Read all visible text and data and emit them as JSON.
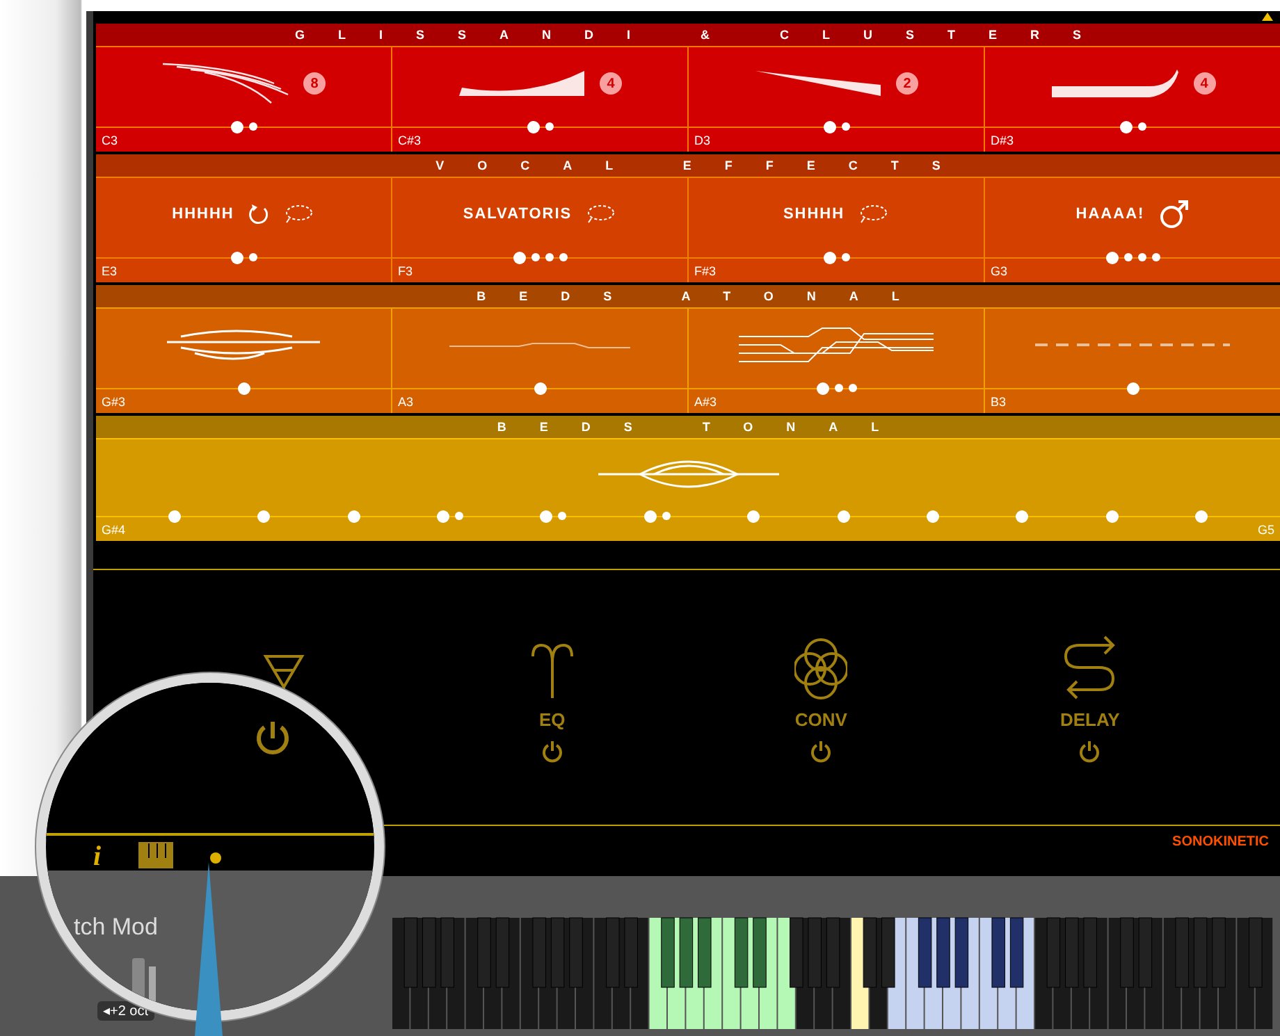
{
  "sections": [
    {
      "title": "GLISSANDI & CLUSTERS",
      "kind": "grid",
      "cells": [
        {
          "note": "C3",
          "badge": "8",
          "dots": [
            {
              "selected": true
            },
            {
              "selected": false
            }
          ]
        },
        {
          "note": "C#3",
          "badge": "4",
          "dots": [
            {
              "selected": true
            },
            {
              "selected": false
            }
          ]
        },
        {
          "note": "D3",
          "badge": "2",
          "dots": [
            {
              "selected": true
            },
            {
              "selected": false
            }
          ]
        },
        {
          "note": "D#3",
          "badge": "4",
          "dots": [
            {
              "selected": true
            },
            {
              "selected": false
            }
          ]
        }
      ]
    },
    {
      "title": "VOCAL EFFECTS",
      "kind": "grid",
      "cells": [
        {
          "note": "E3",
          "label": "HHHHH",
          "kind": "loop-bubble",
          "dots": [
            {
              "selected": true
            },
            {
              "selected": false
            }
          ]
        },
        {
          "note": "F3",
          "label": "SALVATORIS",
          "kind": "bubble",
          "dots": [
            {
              "selected": true
            },
            {
              "selected": false
            },
            {
              "selected": false
            },
            {
              "selected": false
            }
          ]
        },
        {
          "note": "F#3",
          "label": "SHHHH",
          "kind": "bubble",
          "dots": [
            {
              "selected": true
            },
            {
              "selected": false
            }
          ]
        },
        {
          "note": "G3",
          "label": "HAAAA!",
          "kind": "male",
          "dots": [
            {
              "selected": true
            },
            {
              "selected": false
            },
            {
              "selected": false
            },
            {
              "selected": false
            }
          ]
        }
      ]
    },
    {
      "title": "BEDS ATONAL",
      "kind": "grid",
      "cells": [
        {
          "note": "G#3",
          "dots": [
            {
              "selected": true
            }
          ]
        },
        {
          "note": "A3",
          "dots": [
            {
              "selected": true
            }
          ]
        },
        {
          "note": "A#3",
          "dots": [
            {
              "selected": true
            },
            {
              "selected": false
            },
            {
              "selected": false
            }
          ]
        },
        {
          "note": "B3",
          "dots": [
            {
              "selected": true
            }
          ]
        }
      ]
    },
    {
      "title": "BEDS TONAL",
      "kind": "wide",
      "cells": [
        {
          "note": "G#4",
          "note_end": "G5",
          "dots": [
            {
              "selected": true
            },
            {
              "selected": true
            },
            {
              "selected": true
            },
            {
              "selected": true
            },
            {
              "selected": false
            },
            {
              "selected": true
            },
            {
              "selected": false
            },
            {
              "selected": true
            },
            {
              "selected": false
            },
            {
              "selected": true
            },
            {
              "selected": true
            },
            {
              "selected": true
            },
            {
              "selected": true
            },
            {
              "selected": true
            },
            {
              "selected": true
            }
          ]
        }
      ]
    }
  ],
  "effects": [
    {
      "kind": "funnel"
    },
    {
      "kind": "eq",
      "label": "EQ"
    },
    {
      "kind": "conv",
      "label": "CONV"
    },
    {
      "kind": "delay",
      "label": "DELAY"
    }
  ],
  "brand": "SONOKINETIC",
  "magnifier": {
    "info": "i",
    "label": "tch Mod"
  },
  "octave": "◂+2 oct"
}
